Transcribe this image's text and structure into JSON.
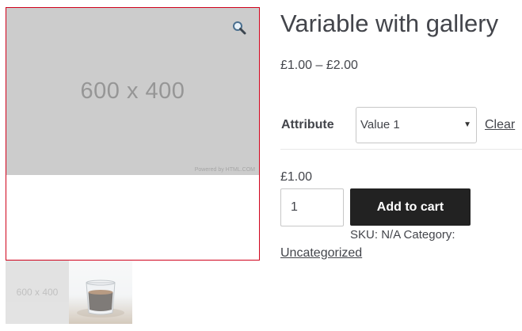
{
  "gallery": {
    "main_image_text": "600 x 400",
    "powered_by": "Powered by HTML.COM",
    "zoom_icon": "magnifier-icon",
    "thumbnails": [
      {
        "text": "600 x 400"
      },
      {
        "text": ""
      }
    ]
  },
  "product": {
    "title": "Variable with gallery",
    "price_range": "£1.00 – £2.00",
    "attribute_label": "Attribute",
    "attribute_selected": "Value 1",
    "clear_label": "Clear",
    "variation_price": "£1.00",
    "quantity": "1",
    "add_to_cart_label": "Add to cart",
    "sku_label": "SKU:",
    "sku_value": "N/A",
    "category_label": "Category:",
    "category_value": "Uncategorized"
  },
  "colors": {
    "gallery_border": "#d0021b",
    "button_bg": "#222222",
    "text": "#43454b"
  }
}
